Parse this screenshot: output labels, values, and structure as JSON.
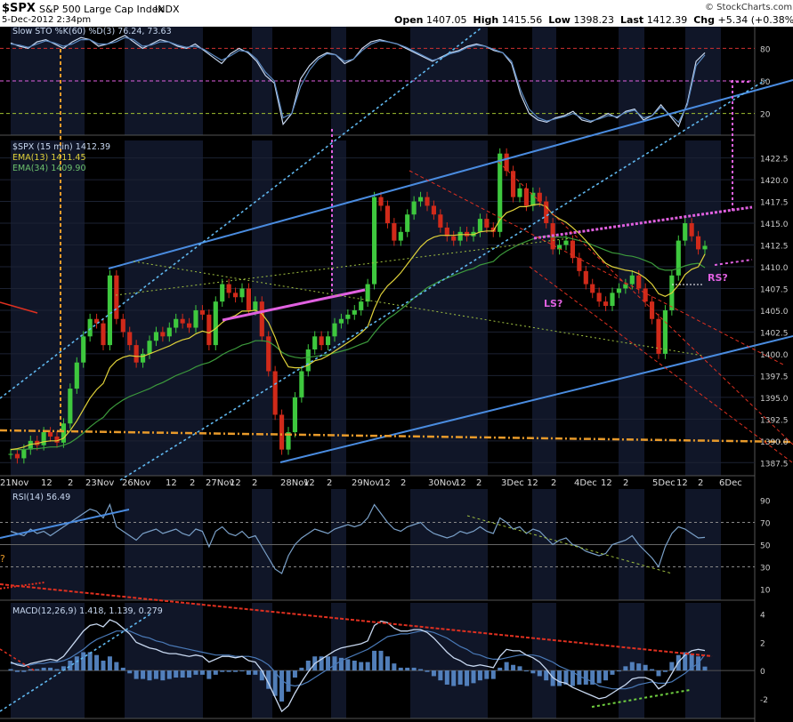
{
  "header": {
    "symbol": "$SPX",
    "name": "S&P 500 Large Cap Index",
    "exchange": "INDX",
    "date": "5-Dec-2012 2:34pm",
    "watermark": "© StockCharts.com",
    "open_label": "Open",
    "open": "1407.05",
    "high_label": "High",
    "high": "1415.56",
    "low_label": "Low",
    "low": "1398.23",
    "last_label": "Last",
    "last": "1412.39",
    "chg_label": "Chg",
    "chg": "+5.34 (+0.38%)"
  },
  "colors": {
    "background": "#000000",
    "session_band": "#101628",
    "up_candle": "#3ec83e",
    "down_candle": "#d02a1a",
    "ema13": "#e0d23a",
    "ema34": "#3c9a3c",
    "trend_blue": "#4a8ce0",
    "magenta": "#e060e0",
    "orange": "#e89a2a",
    "red_dash": "#e03020",
    "indicator_line": "#7aa0c8"
  },
  "chart_data": [
    {
      "type": "line",
      "panel": "Slow STO",
      "legend": "Slow STO %K(60) %D(3) 76.24, 73.63",
      "yticks": [
        80,
        50,
        20
      ],
      "ylim": [
        0,
        100
      ],
      "x": [
        0,
        10,
        20,
        30,
        40,
        50,
        60,
        70,
        80,
        90,
        100,
        110,
        120,
        130,
        140,
        150,
        160,
        170,
        180,
        190,
        200,
        210,
        220,
        230,
        240,
        250,
        260,
        270,
        280,
        290,
        300,
        310,
        320,
        330,
        340,
        350,
        360,
        370,
        380,
        390,
        400,
        410,
        420,
        430,
        440,
        450,
        460,
        470,
        480,
        490,
        500,
        510,
        520,
        530,
        540,
        550,
        560,
        570,
        580,
        590,
        600,
        610,
        620,
        630,
        640,
        650,
        660,
        670,
        680,
        690,
        700,
        710,
        720,
        730,
        740,
        750,
        760,
        770,
        780,
        790
      ],
      "series": [
        {
          "name": "%K(60)",
          "values": [
            85,
            82,
            80,
            86,
            88,
            84,
            80,
            86,
            90,
            88,
            82,
            84,
            88,
            92,
            86,
            80,
            84,
            88,
            86,
            82,
            80,
            84,
            78,
            72,
            66,
            75,
            80,
            76,
            68,
            55,
            48,
            10,
            20,
            52,
            64,
            72,
            76,
            74,
            66,
            70,
            80,
            86,
            88,
            86,
            84,
            80,
            76,
            72,
            68,
            72,
            76,
            78,
            82,
            84,
            82,
            78,
            76,
            66,
            38,
            20,
            14,
            12,
            16,
            18,
            22,
            14,
            12,
            16,
            20,
            16,
            22,
            24,
            14,
            18,
            28,
            18,
            8,
            30,
            68,
            76
          ]
        },
        {
          "name": "%D(3)",
          "values": [
            84,
            83,
            81,
            84,
            87,
            85,
            82,
            84,
            88,
            88,
            84,
            84,
            86,
            90,
            88,
            82,
            83,
            86,
            86,
            83,
            81,
            82,
            79,
            74,
            69,
            73,
            78,
            77,
            70,
            58,
            50,
            16,
            20,
            45,
            60,
            70,
            75,
            74,
            68,
            70,
            78,
            84,
            87,
            86,
            84,
            81,
            77,
            73,
            69,
            71,
            75,
            77,
            81,
            83,
            82,
            79,
            76,
            68,
            42,
            24,
            16,
            13,
            15,
            17,
            20,
            16,
            13,
            15,
            18,
            17,
            21,
            23,
            16,
            18,
            26,
            19,
            12,
            28,
            64,
            74
          ]
        }
      ],
      "levels": [
        {
          "value": 80,
          "color": "#d03030"
        },
        {
          "value": 50,
          "color": "#e060e0"
        },
        {
          "value": 20,
          "color": "#a0c030"
        }
      ]
    },
    {
      "type": "candlestick",
      "panel": "$SPX (15 min)",
      "legend": [
        "$SPX (15 min) 1412.39",
        "EMA(13) 1411.45",
        "EMA(34) 1409.90"
      ],
      "yticks": [
        1422.5,
        1420.0,
        1417.5,
        1415.0,
        1412.5,
        1410.0,
        1407.5,
        1405.0,
        1402.5,
        1400.0,
        1397.5,
        1395.0,
        1392.5,
        1390.0,
        1387.5
      ],
      "ylim": [
        1386.0,
        1424.5
      ],
      "x_ticks": [
        "21Nov",
        "12",
        "2",
        "23Nov",
        "26Nov",
        "12",
        "2",
        "27Nov",
        "12",
        "2",
        "28Nov",
        "12",
        "2",
        "29Nov",
        "12",
        "2",
        "30Nov",
        "12",
        "2",
        "3Dec",
        "12",
        "2",
        "4Dec",
        "12",
        "2",
        "5Dec",
        "12",
        "2",
        "6Dec"
      ],
      "close": [
        1388.5,
        1388.0,
        1389.0,
        1390.0,
        1389.5,
        1391.0,
        1390.5,
        1389.8,
        1392.0,
        1396.0,
        1399.0,
        1402.0,
        1404.0,
        1403.5,
        1401.0,
        1409.0,
        1404.0,
        1402.5,
        1401.0,
        1399.0,
        1400.0,
        1401.5,
        1402.5,
        1402.0,
        1403.0,
        1404.0,
        1403.5,
        1403.0,
        1405.0,
        1404.5,
        1401.0,
        1406.0,
        1408.0,
        1407.0,
        1406.5,
        1407.5,
        1405.0,
        1406.0,
        1402.0,
        1398.0,
        1393.0,
        1389.0,
        1391.0,
        1395.0,
        1398.0,
        1400.5,
        1402.0,
        1401.0,
        1402.0,
        1403.5,
        1404.0,
        1404.5,
        1405.0,
        1406.0,
        1408.0,
        1418.0,
        1417.0,
        1415.0,
        1413.0,
        1414.0,
        1416.0,
        1417.5,
        1418.0,
        1417.0,
        1416.0,
        1414.5,
        1413.5,
        1413.0,
        1414.0,
        1413.5,
        1414.0,
        1415.5,
        1414.5,
        1414.0,
        1423.0,
        1421.0,
        1418.0,
        1419.0,
        1417.0,
        1418.5,
        1417.5,
        1415.0,
        1412.0,
        1412.5,
        1413.0,
        1411.0,
        1409.5,
        1408.0,
        1407.0,
        1406.0,
        1405.5,
        1407.0,
        1407.5,
        1408.0,
        1409.0,
        1407.5,
        1406.0,
        1404.0,
        1400.0,
        1405.0,
        1409.0,
        1413.0,
        1415.0,
        1413.5,
        1412.0,
        1412.4
      ],
      "ema13": [
        1389.0,
        1389.1,
        1389.3,
        1389.6,
        1389.7,
        1389.9,
        1390.0,
        1390.0,
        1390.3,
        1391.2,
        1392.3,
        1393.6,
        1394.9,
        1395.9,
        1396.6,
        1398.4,
        1399.2,
        1399.6,
        1399.8,
        1399.7,
        1399.7,
        1400.0,
        1400.3,
        1400.6,
        1400.9,
        1401.3,
        1401.6,
        1401.8,
        1402.3,
        1402.6,
        1402.4,
        1402.9,
        1403.6,
        1404.1,
        1404.4,
        1404.9,
        1404.9,
        1405.0,
        1404.6,
        1403.6,
        1401.9,
        1399.8,
        1398.5,
        1398.4,
        1398.4,
        1398.7,
        1399.2,
        1399.4,
        1399.8,
        1400.3,
        1400.8,
        1401.3,
        1401.8,
        1402.4,
        1403.1,
        1405.2,
        1406.8,
        1407.8,
        1408.5,
        1409.3,
        1410.3,
        1411.3,
        1412.3,
        1413.0,
        1413.4,
        1413.6,
        1413.6,
        1413.6,
        1413.7,
        1413.7,
        1413.7,
        1414.0,
        1414.1,
        1414.1,
        1415.4,
        1416.2,
        1416.5,
        1416.9,
        1416.9,
        1417.1,
        1417.2,
        1416.9,
        1416.0,
        1415.5,
        1415.1,
        1414.5,
        1413.8,
        1413.0,
        1412.1,
        1411.2,
        1410.4,
        1410.0,
        1409.8,
        1409.6,
        1409.5,
        1409.2,
        1408.7,
        1408.0,
        1406.9,
        1406.6,
        1407.0,
        1407.9,
        1409.1,
        1409.7,
        1410.0,
        1411.45
      ],
      "ema34": [
        1389.0,
        1389.0,
        1389.0,
        1389.1,
        1389.1,
        1389.2,
        1389.3,
        1389.3,
        1389.5,
        1389.8,
        1390.3,
        1390.9,
        1391.6,
        1392.2,
        1392.7,
        1393.6,
        1394.2,
        1394.7,
        1395.1,
        1395.4,
        1395.7,
        1396.0,
        1396.4,
        1396.7,
        1397.1,
        1397.5,
        1397.8,
        1398.1,
        1398.5,
        1398.8,
        1399.0,
        1399.4,
        1399.9,
        1400.3,
        1400.6,
        1401.0,
        1401.2,
        1401.5,
        1401.5,
        1401.4,
        1400.9,
        1400.2,
        1399.8,
        1399.6,
        1399.5,
        1399.6,
        1399.7,
        1399.8,
        1399.9,
        1400.1,
        1400.3,
        1400.5,
        1400.8,
        1401.1,
        1401.4,
        1402.4,
        1403.3,
        1404.0,
        1404.5,
        1405.1,
        1405.7,
        1406.4,
        1407.0,
        1407.6,
        1408.0,
        1408.4,
        1408.7,
        1409.0,
        1409.3,
        1409.6,
        1409.8,
        1410.2,
        1410.4,
        1410.6,
        1411.3,
        1411.8,
        1412.2,
        1412.6,
        1412.9,
        1413.2,
        1413.4,
        1413.5,
        1413.4,
        1413.4,
        1413.4,
        1413.2,
        1413.0,
        1412.8,
        1412.5,
        1412.2,
        1411.9,
        1411.6,
        1411.5,
        1411.3,
        1411.2,
        1411.0,
        1410.7,
        1410.4,
        1409.8,
        1409.6,
        1409.6,
        1409.8,
        1410.1,
        1410.3,
        1410.4,
        1409.9
      ]
    },
    {
      "type": "line",
      "panel": "RSI",
      "legend": "RSI(14) 56.49",
      "yticks": [
        90,
        70,
        50,
        30,
        10
      ],
      "ylim": [
        0,
        100
      ],
      "values": [
        62,
        60,
        58,
        64,
        60,
        62,
        58,
        62,
        66,
        70,
        74,
        78,
        82,
        80,
        74,
        86,
        66,
        62,
        58,
        54,
        60,
        62,
        64,
        60,
        62,
        64,
        60,
        58,
        64,
        62,
        48,
        62,
        66,
        60,
        58,
        62,
        56,
        58,
        48,
        38,
        28,
        24,
        40,
        50,
        56,
        60,
        64,
        62,
        60,
        64,
        66,
        68,
        66,
        68,
        74,
        86,
        78,
        70,
        64,
        62,
        66,
        68,
        70,
        64,
        60,
        58,
        56,
        58,
        62,
        60,
        62,
        66,
        62,
        60,
        74,
        70,
        64,
        66,
        60,
        64,
        62,
        56,
        50,
        54,
        56,
        50,
        48,
        44,
        42,
        40,
        42,
        50,
        52,
        54,
        58,
        50,
        44,
        38,
        30,
        48,
        60,
        66,
        64,
        60,
        56,
        56.49
      ],
      "annotation": "?"
    },
    {
      "type": "line",
      "panel": "MACD",
      "legend": "MACD(12,26,9) 1.418, 1.139, 0.279",
      "yticks": [
        4,
        2,
        0,
        -2
      ],
      "ylim": [
        -3.4,
        4.8
      ],
      "series": [
        {
          "name": "MACD",
          "values": [
            0.6,
            0.4,
            0.3,
            0.5,
            0.6,
            0.7,
            0.8,
            0.7,
            1.0,
            1.6,
            2.2,
            2.8,
            3.2,
            3.3,
            3.1,
            3.6,
            3.4,
            3.0,
            2.6,
            2.0,
            1.8,
            1.6,
            1.5,
            1.3,
            1.2,
            1.2,
            1.1,
            1.0,
            1.1,
            1.0,
            0.6,
            0.8,
            1.0,
            1.0,
            0.9,
            1.0,
            0.7,
            0.6,
            0.0,
            -0.9,
            -1.9,
            -2.9,
            -2.5,
            -1.6,
            -0.8,
            -0.1,
            0.5,
            0.8,
            1.1,
            1.4,
            1.6,
            1.7,
            1.8,
            1.9,
            2.1,
            3.2,
            3.5,
            3.4,
            3.0,
            2.8,
            2.8,
            2.9,
            2.9,
            2.7,
            2.3,
            1.8,
            1.3,
            0.9,
            0.7,
            0.4,
            0.3,
            0.4,
            0.3,
            0.2,
            1.0,
            1.5,
            1.4,
            1.4,
            1.1,
            0.9,
            0.6,
            0.1,
            -0.5,
            -0.8,
            -0.9,
            -1.2,
            -1.4,
            -1.6,
            -1.8,
            -2.0,
            -1.9,
            -1.6,
            -1.3,
            -1.0,
            -0.6,
            -0.5,
            -0.5,
            -0.7,
            -1.3,
            -1.0,
            -0.2,
            0.6,
            1.1,
            1.4,
            1.5,
            1.418
          ]
        },
        {
          "name": "Signal",
          "values": [
            0.5,
            0.5,
            0.4,
            0.4,
            0.5,
            0.5,
            0.6,
            0.6,
            0.7,
            0.9,
            1.2,
            1.5,
            1.9,
            2.2,
            2.4,
            2.6,
            2.8,
            2.8,
            2.8,
            2.6,
            2.4,
            2.3,
            2.1,
            2.0,
            1.8,
            1.7,
            1.6,
            1.5,
            1.4,
            1.3,
            1.2,
            1.1,
            1.1,
            1.1,
            1.0,
            1.0,
            1.0,
            0.9,
            0.7,
            0.4,
            -0.1,
            -0.7,
            -1.0,
            -1.1,
            -1.0,
            -0.8,
            -0.5,
            -0.2,
            0.1,
            0.4,
            0.7,
            0.9,
            1.1,
            1.3,
            1.5,
            1.8,
            2.1,
            2.4,
            2.5,
            2.6,
            2.6,
            2.7,
            2.8,
            2.8,
            2.7,
            2.5,
            2.3,
            2.0,
            1.7,
            1.5,
            1.2,
            1.1,
            0.9,
            0.8,
            0.8,
            0.9,
            1.0,
            1.1,
            1.1,
            1.1,
            1.0,
            0.8,
            0.6,
            0.3,
            0.1,
            -0.1,
            -0.4,
            -0.6,
            -0.8,
            -1.1,
            -1.2,
            -1.3,
            -1.3,
            -1.3,
            -1.2,
            -1.0,
            -0.9,
            -0.8,
            -0.9,
            -0.9,
            -0.8,
            -0.5,
            -0.2,
            0.2,
            0.5,
            1.139
          ]
        }
      ],
      "histogram_values": [
        0.1,
        -0.1,
        -0.1,
        0.1,
        0.1,
        0.2,
        0.2,
        0.1,
        0.3,
        0.7,
        1.0,
        1.3,
        1.3,
        1.1,
        0.7,
        1.0,
        0.6,
        0.2,
        -0.2,
        -0.6,
        -0.6,
        -0.7,
        -0.6,
        -0.7,
        -0.6,
        -0.5,
        -0.5,
        -0.5,
        -0.3,
        -0.3,
        -0.6,
        -0.3,
        -0.1,
        -0.1,
        -0.1,
        0.0,
        -0.3,
        -0.3,
        -0.7,
        -1.3,
        -1.8,
        -2.2,
        -1.5,
        -0.5,
        0.2,
        0.7,
        1.0,
        1.0,
        1.0,
        1.0,
        0.9,
        0.8,
        0.7,
        0.6,
        0.6,
        1.4,
        1.4,
        1.0,
        0.5,
        0.2,
        0.2,
        0.2,
        0.1,
        -0.1,
        -0.4,
        -0.7,
        -1.0,
        -1.1,
        -1.0,
        -1.1,
        -0.9,
        -0.7,
        -0.6,
        -0.6,
        0.2,
        0.6,
        0.4,
        0.3,
        0.0,
        -0.2,
        -0.4,
        -0.7,
        -1.1,
        -1.1,
        -1.0,
        -1.1,
        -1.0,
        -1.0,
        -1.0,
        -0.9,
        -0.7,
        -0.3,
        0.0,
        0.3,
        0.6,
        0.5,
        0.4,
        0.1,
        -0.4,
        -0.1,
        0.6,
        1.1,
        1.3,
        1.2,
        1.0,
        0.279
      ]
    }
  ],
  "annotations": {
    "ls_label": "LS?",
    "rs_label": "RS?"
  }
}
